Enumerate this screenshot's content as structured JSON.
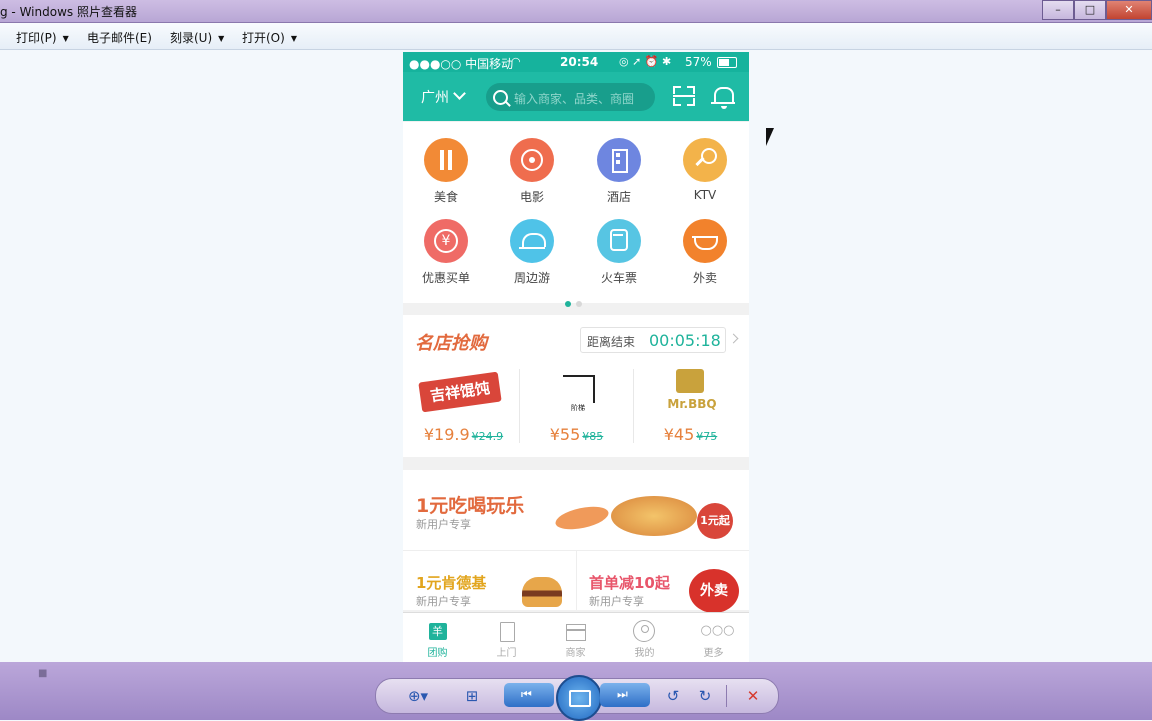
{
  "window": {
    "title": "g - Windows 照片查看器",
    "minimize_glyph": "–",
    "maximize_glyph": "□",
    "close_glyph": "✕"
  },
  "menu": [
    {
      "label": "打印(P)",
      "has_arrow": true
    },
    {
      "label": "电子邮件(E)",
      "has_arrow": false
    },
    {
      "label": "刻录(U)",
      "has_arrow": true
    },
    {
      "label": "打开(O)",
      "has_arrow": true
    }
  ],
  "phone": {
    "status": {
      "carrier": "●●●○○ 中国移动",
      "time": "20:54",
      "battery": "57%"
    },
    "header": {
      "city": "广州",
      "search_placeholder": "输入商家、品类、商圈"
    },
    "categories": [
      {
        "label": "美食",
        "color": "#f28a36",
        "icon": "fork-knife-icon",
        "glyph": "🍴"
      },
      {
        "label": "电影",
        "color": "#ef6d4e",
        "icon": "film-reel-icon",
        "glyph": "✇"
      },
      {
        "label": "酒店",
        "color": "#6e86e0",
        "icon": "hotel-icon",
        "glyph": "▦"
      },
      {
        "label": "KTV",
        "color": "#f3b34a",
        "icon": "microphone-icon",
        "glyph": "🎤"
      },
      {
        "label": "优惠买单",
        "color": "#ef6b66",
        "icon": "yuan-coupon-icon",
        "glyph": "¥"
      },
      {
        "label": "周边游",
        "color": "#4fc3e8",
        "icon": "travel-icon",
        "glyph": "⛰"
      },
      {
        "label": "火车票",
        "color": "#57c5e3",
        "icon": "train-icon",
        "glyph": "🚆"
      },
      {
        "label": "外卖",
        "color": "#f2822c",
        "icon": "takeout-bowl-icon",
        "glyph": "🍜"
      }
    ],
    "page_dots": {
      "active": "#1fb39b",
      "inactive": "#d8d8d8"
    },
    "flash_sale": {
      "title": "名店抢购",
      "timer_label": "距离结束",
      "timer_value": "00:05:18",
      "shops": [
        {
          "logo_text": "吉祥馄饨",
          "price": "¥19.9",
          "original": "¥24.9"
        },
        {
          "logo_text": "阶梯",
          "price": "¥55",
          "original": "¥85"
        },
        {
          "logo_text": "Mr.BBQ",
          "price": "¥45",
          "original": "¥75"
        }
      ]
    },
    "promo": {
      "banner_title": "1元吃喝玩乐",
      "banner_sub": "新用户专享",
      "badge": "1元起",
      "left_title": "1元肯德基",
      "left_sub": "新用户专享",
      "right_title": "首单减10起",
      "right_sub": "新用户专享",
      "right_badge": "外卖"
    },
    "tabs": [
      {
        "label": "团购",
        "icon": "group-buy-icon",
        "active": true
      },
      {
        "label": "上门",
        "icon": "door-icon",
        "active": false
      },
      {
        "label": "商家",
        "icon": "shop-icon",
        "active": false
      },
      {
        "label": "我的",
        "icon": "profile-icon",
        "active": false
      },
      {
        "label": "更多",
        "icon": "more-icon",
        "active": false
      }
    ]
  },
  "toolbar": {
    "zoom": "zoom-icon",
    "actual_size": "actual-size-icon",
    "previous": "previous-icon",
    "slideshow": "slideshow-icon",
    "next": "next-icon",
    "rotate_ccw": "rotate-counterclockwise-icon",
    "rotate_cw": "rotate-clockwise-icon",
    "delete": "delete-icon"
  },
  "colors": {
    "accent": "#1fbba5",
    "orange": "#e26a3e",
    "taskbar": "#a994cf"
  }
}
